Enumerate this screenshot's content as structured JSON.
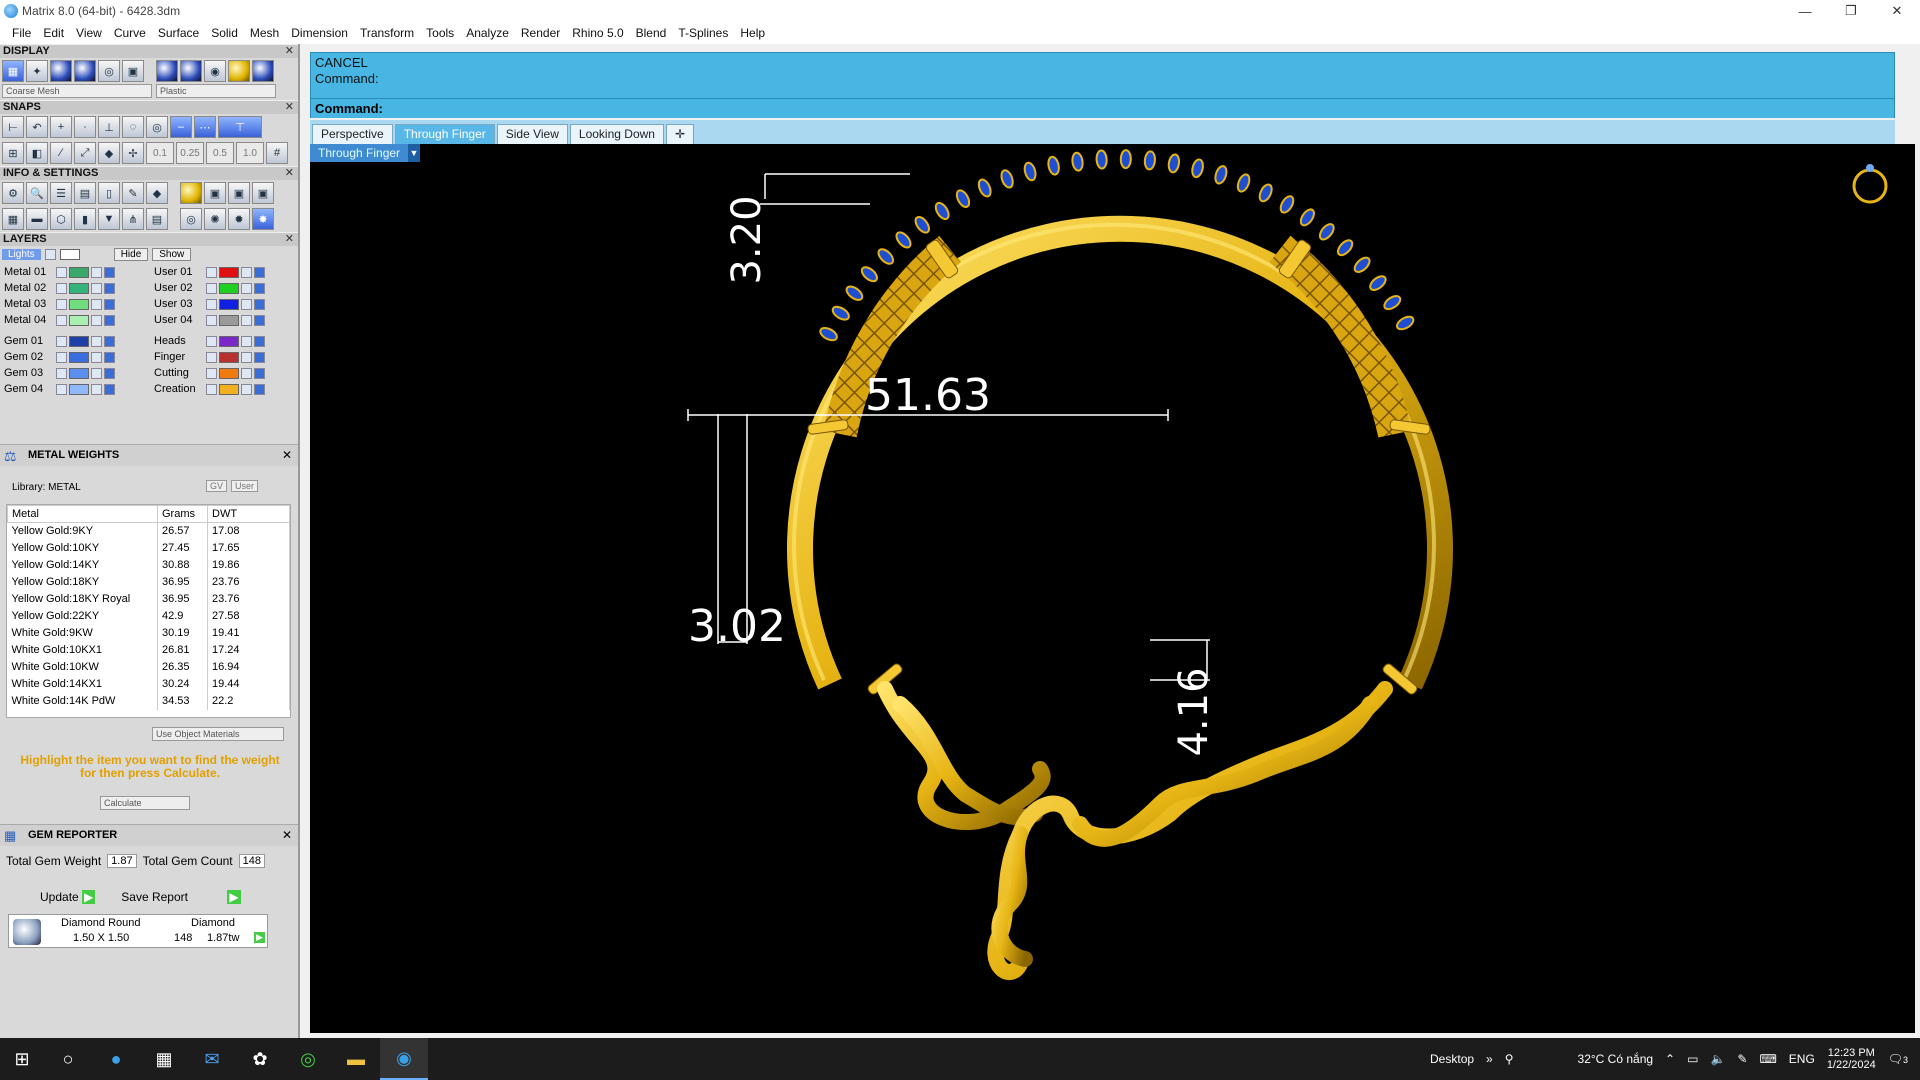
{
  "window": {
    "title": "Matrix 8.0 (64-bit) - 6428.3dm",
    "minimize": "—",
    "restore": "❐",
    "close": "✕"
  },
  "menu": [
    "File",
    "Edit",
    "View",
    "Curve",
    "Surface",
    "Solid",
    "Mesh",
    "Dimension",
    "Transform",
    "Tools",
    "Analyze",
    "Render",
    "Rhino 5.0",
    "Blend",
    "T-Splines",
    "Help"
  ],
  "display": {
    "title": "DISPLAY",
    "mesh_select": "Coarse Mesh",
    "material_select": "Plastic"
  },
  "snaps": {
    "title": "SNAPS",
    "steps": [
      "0.1",
      "0.25",
      "0.5",
      "1.0"
    ]
  },
  "info": {
    "title": "INFO & SETTINGS"
  },
  "layers": {
    "title": "LAYERS",
    "lights_label": "Lights",
    "hide_label": "Hide",
    "show_label": "Show",
    "left": [
      {
        "name": "Metal 01",
        "color": "#3aa86b"
      },
      {
        "name": "Metal 02",
        "color": "#34b37a"
      },
      {
        "name": "Metal 03",
        "color": "#6fde7c"
      },
      {
        "name": "Metal 04",
        "color": "#a8f0b0"
      },
      {
        "name": "Gem 01",
        "color": "#1c3fa8"
      },
      {
        "name": "Gem 02",
        "color": "#3a6ee0"
      },
      {
        "name": "Gem 03",
        "color": "#5a8ff0"
      },
      {
        "name": "Gem 04",
        "color": "#8fb8ff"
      }
    ],
    "right": [
      {
        "name": "User 01",
        "color": "#e01010"
      },
      {
        "name": "User 02",
        "color": "#20d020"
      },
      {
        "name": "User 03",
        "color": "#1020e0"
      },
      {
        "name": "User 04",
        "color": "#9a9a9a"
      },
      {
        "name": "Heads",
        "color": "#7a28c8"
      },
      {
        "name": "Finger",
        "color": "#b83030"
      },
      {
        "name": "Cutting",
        "color": "#f07a10"
      },
      {
        "name": "Creation",
        "color": "#f0b020"
      }
    ]
  },
  "metal_weights": {
    "title": "METAL WEIGHTS",
    "library": "Library: METAL",
    "btn_gv": "GV",
    "btn_user": "User",
    "columns": [
      "Metal",
      "Grams",
      "DWT"
    ],
    "rows": [
      [
        "Yellow Gold:9KY",
        "26.57",
        "17.08"
      ],
      [
        "Yellow Gold:10KY",
        "27.45",
        "17.65"
      ],
      [
        "Yellow Gold:14KY",
        "30.88",
        "19.86"
      ],
      [
        "Yellow Gold:18KY",
        "36.95",
        "23.76"
      ],
      [
        "Yellow Gold:18KY Royal",
        "36.95",
        "23.76"
      ],
      [
        "Yellow Gold:22KY",
        "42.9",
        "27.58"
      ],
      [
        "White Gold:9KW",
        "30.19",
        "19.41"
      ],
      [
        "White Gold:10KX1",
        "26.81",
        "17.24"
      ],
      [
        "White Gold:10KW",
        "26.35",
        "16.94"
      ],
      [
        "White Gold:14KX1",
        "30.24",
        "19.44"
      ],
      [
        "White Gold:14K PdW",
        "34.53",
        "22.2"
      ]
    ],
    "use_object_materials": "Use Object Materials",
    "hint": "Highlight the item you want to find the weight for then press Calculate.",
    "calculate": "Calculate"
  },
  "gem_reporter": {
    "title": "GEM REPORTER",
    "total_weight_label": "Total Gem Weight",
    "total_weight": "1.87",
    "total_count_label": "Total Gem Count",
    "total_count": "148",
    "update": "Update",
    "save_report": "Save Report",
    "gem_shape": "Diamond Round",
    "gem_size": "1.50 X 1.50",
    "gem_material": "Diamond",
    "gem_count": "148",
    "gem_weight": "1.87tw"
  },
  "command": {
    "line1": "CANCEL",
    "line2": "Command:",
    "prompt": "Command:"
  },
  "viewport_tabs": [
    "Perspective",
    "Through Finger",
    "Side View",
    "Looking Down"
  ],
  "active_view": "Through Finger",
  "dimensions": {
    "top_gap": "3.20",
    "inner_diameter": "51.63",
    "left_wire": "3.02",
    "right_wire": "4.16"
  },
  "taskbar": {
    "desktop": "Desktop",
    "weather": "32°C  Có nắng",
    "lang": "ENG",
    "time": "12:23 PM",
    "date": "1/22/2024",
    "notif": "3"
  },
  "colors": {
    "gold": "#e6b414",
    "command_bg": "#47b6e3",
    "tab_active": "#58b7e6"
  }
}
